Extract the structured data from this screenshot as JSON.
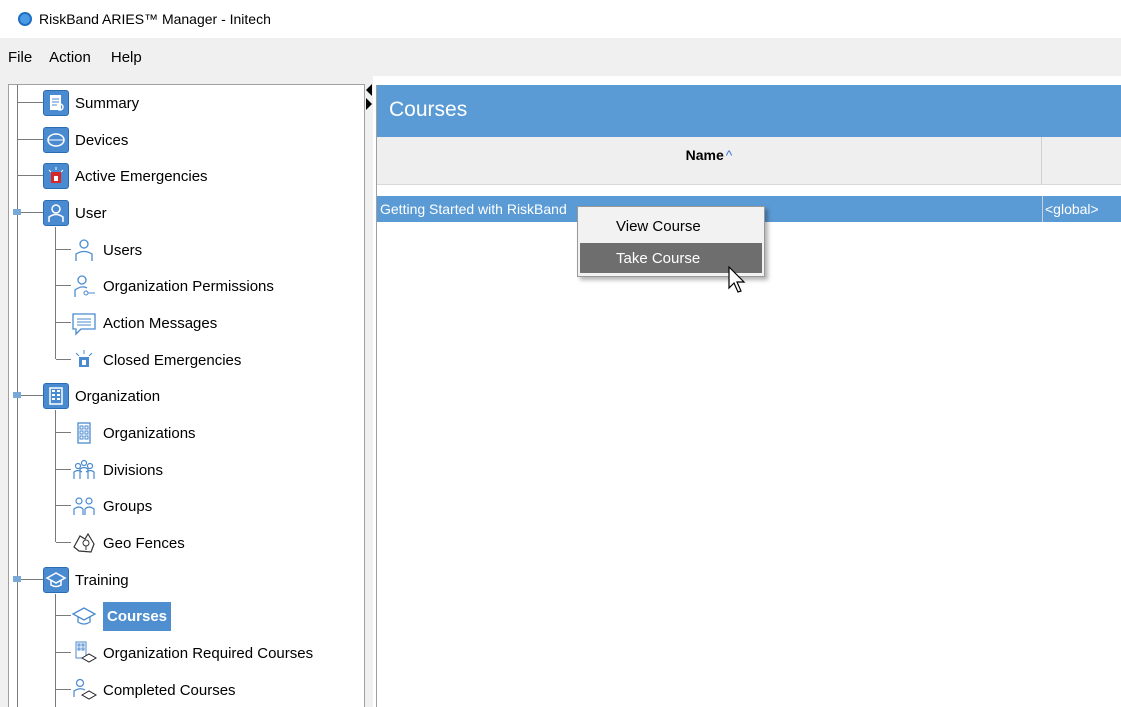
{
  "window": {
    "title": "RiskBand ARIES™ Manager - Initech"
  },
  "menubar": {
    "items": [
      "File",
      "Action",
      "Help"
    ]
  },
  "tree": {
    "summary": "Summary",
    "devices": "Devices",
    "active_emergencies": "Active Emergencies",
    "user": "User",
    "users": "Users",
    "org_permissions": "Organization Permissions",
    "action_messages": "Action Messages",
    "closed_emergencies": "Closed Emergencies",
    "organization": "Organization",
    "organizations": "Organizations",
    "divisions": "Divisions",
    "groups": "Groups",
    "geo_fences": "Geo Fences",
    "training": "Training",
    "courses": "Courses",
    "org_required_courses": "Organization Required Courses",
    "completed_courses": "Completed Courses"
  },
  "content": {
    "header": "Courses",
    "columns": {
      "name": "Name",
      "sort_indicator": "^"
    },
    "rows": [
      {
        "name": "Getting Started with RiskBand",
        "scope": "<global>"
      }
    ]
  },
  "context_menu": {
    "items": [
      "View Course",
      "Take Course"
    ],
    "highlighted": "Take Course"
  },
  "colors": {
    "accent": "#5b9bd5",
    "selection": "#4f8fd0",
    "menu_hover": "#6e6e6e"
  }
}
